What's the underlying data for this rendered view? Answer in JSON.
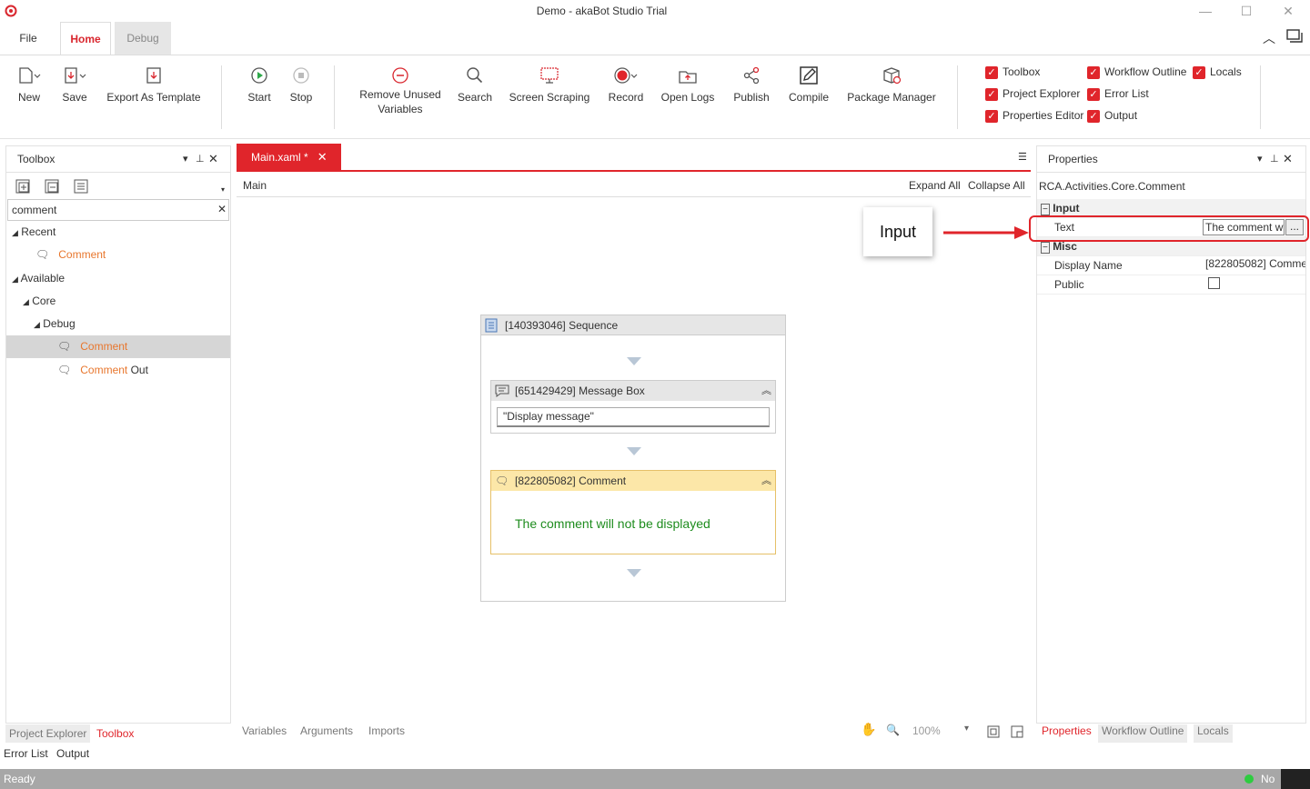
{
  "window": {
    "title": "Demo - akaBot Studio Trial"
  },
  "menu_tabs": {
    "file": "File",
    "home": "Home",
    "debug": "Debug"
  },
  "ribbon": {
    "new": "New",
    "save": "Save",
    "export_template": "Export As Template",
    "start": "Start",
    "stop": "Stop",
    "remove_unused_1": "Remove Unused",
    "remove_unused_2": "Variables",
    "search": "Search",
    "screen_scraping": "Screen Scraping",
    "record": "Record",
    "open_logs": "Open Logs",
    "publish": "Publish",
    "compile": "Compile",
    "package_manager": "Package Manager"
  },
  "view_toggles": {
    "toolbox": "Toolbox",
    "workflow_outline": "Workflow Outline",
    "locals": "Locals",
    "project_explorer": "Project Explorer",
    "error_list": "Error List",
    "properties_editor": "Properties Editor",
    "output": "Output"
  },
  "toolbox": {
    "title": "Toolbox",
    "search_value": "comment",
    "recent": "Recent",
    "recent_comment": "Comment",
    "available": "Available",
    "core": "Core",
    "debug": "Debug",
    "comment": "Comment",
    "comment_out_a": "Comment",
    "comment_out_b": " Out"
  },
  "designer": {
    "doc_tab": "Main.xaml *",
    "breadcrumb": "Main",
    "expand_all": "Expand All",
    "collapse_all": "Collapse All",
    "sequence_title": "[140393046] Sequence",
    "msgbox_title": "[651429429] Message Box",
    "msgbox_value": "\"Display message\"",
    "comment_title": "[822805082] Comment",
    "comment_text": "The comment will not be displayed",
    "callout": "Input",
    "bottom_tabs": {
      "variables": "Variables",
      "arguments": "Arguments",
      "imports": "Imports"
    },
    "zoom": "100%"
  },
  "properties": {
    "title": "Properties",
    "type_name": "RCA.Activities.Core.Comment",
    "input_cat": "Input",
    "text_label": "Text",
    "text_value": "The comment wi",
    "ellipsis": "...",
    "misc_cat": "Misc",
    "display_name_label": "Display Name",
    "display_name_value": "[822805082] Comme",
    "public_label": "Public"
  },
  "left_bottom_tabs": {
    "project_explorer": "Project Explorer",
    "toolbox": "Toolbox"
  },
  "right_bottom_tabs": {
    "properties": "Properties",
    "workflow_outline": "Workflow Outline",
    "locals": "Locals"
  },
  "output_tabs": {
    "error_list": "Error List",
    "output": "Output"
  },
  "status": {
    "text": "Ready",
    "right": "No"
  },
  "colors": {
    "accent": "#e0252b",
    "orange": "#e8772e",
    "comment_bg": "#fff7dc",
    "comment_text": "#1e8c1e"
  }
}
